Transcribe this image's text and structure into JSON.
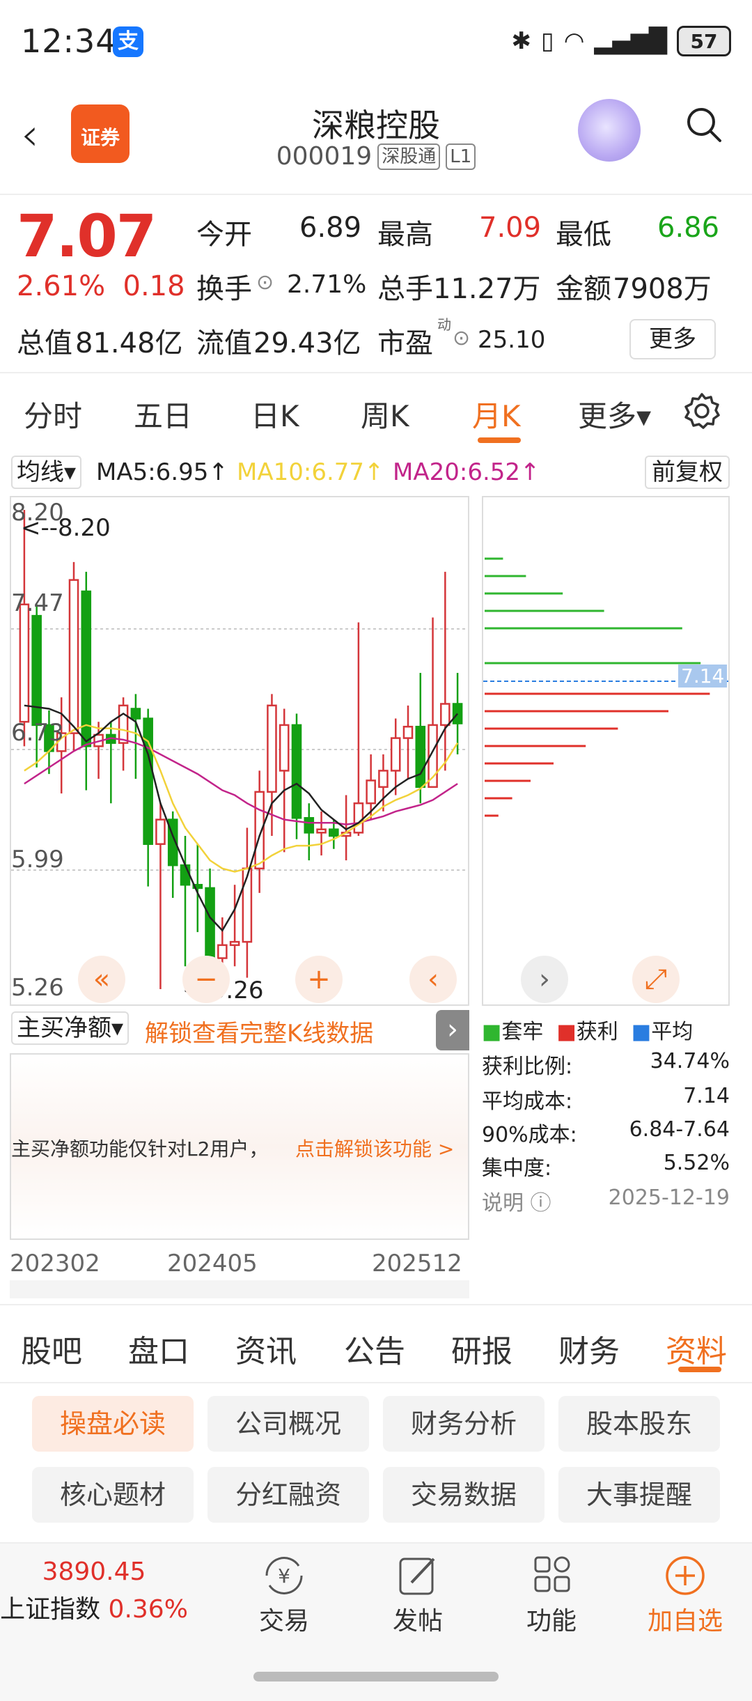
{
  "status_bar": {
    "time": "12:34",
    "alipay_badge": "支",
    "battery": "57"
  },
  "header": {
    "back_icon": "back-chevron-icon",
    "logo_text": "证券",
    "stock_name": "深粮控股",
    "stock_code": "000019",
    "tag_connect": "深股通",
    "tag_level": "L1"
  },
  "quote": {
    "price": "7.07",
    "change_pct": "2.61%",
    "change_amt": "0.18",
    "open_label": "今开",
    "open": "6.89",
    "high_label": "最高",
    "high": "7.09",
    "low_label": "最低",
    "low": "6.86",
    "turnover_label": "换手",
    "turnover": "2.71%",
    "volume_label": "总手",
    "volume": "11.27万",
    "amount_label": "金额",
    "amount": "7908万",
    "mktcap_label": "总值",
    "mktcap": "81.48亿",
    "float_label": "流值",
    "float": "29.43亿",
    "pe_label": "市盈",
    "pe_sup": "动",
    "pe": "25.10",
    "more_button": "更多"
  },
  "chart_tabs": [
    "分时",
    "五日",
    "日K",
    "周K",
    "月K",
    "更多▾"
  ],
  "active_chart_tab": "月K",
  "ma": {
    "selector": "均线▾",
    "ma5": "MA5:6.95↑",
    "ma10": "MA10:6.77↑",
    "ma20": "MA20:6.52↑",
    "adjust_button": "前复权",
    "ma5_color": "#222222",
    "ma10_color": "#f2d23a",
    "ma20_color": "#c2248a"
  },
  "kline": {
    "y_labels": [
      "8.20",
      "7.47",
      "6.73",
      "5.99",
      "5.26"
    ],
    "max_label": "<--8.20",
    "min_label": "<-5.26",
    "dates": [
      "202302",
      "202405",
      "202512"
    ],
    "up_color": "#d4363a",
    "down_color": "#13a013"
  },
  "chart_data": {
    "type": "candlestick",
    "ylim": [
      5.26,
      8.2
    ],
    "candles": [
      {
        "o": 6.9,
        "h": 8.2,
        "l": 6.75,
        "c": 7.62
      },
      {
        "o": 7.55,
        "h": 7.62,
        "l": 6.62,
        "c": 6.88
      },
      {
        "o": 6.88,
        "h": 6.97,
        "l": 6.58,
        "c": 6.72
      },
      {
        "o": 6.72,
        "h": 7.05,
        "l": 6.46,
        "c": 6.83
      },
      {
        "o": 6.83,
        "h": 7.88,
        "l": 6.72,
        "c": 7.77
      },
      {
        "o": 7.7,
        "h": 7.82,
        "l": 6.48,
        "c": 6.75
      },
      {
        "o": 6.75,
        "h": 6.9,
        "l": 6.55,
        "c": 6.82
      },
      {
        "o": 6.82,
        "h": 6.9,
        "l": 6.4,
        "c": 6.77
      },
      {
        "o": 6.77,
        "h": 7.05,
        "l": 6.6,
        "c": 7.0
      },
      {
        "o": 6.98,
        "h": 7.07,
        "l": 6.55,
        "c": 6.92
      },
      {
        "o": 6.92,
        "h": 6.98,
        "l": 5.89,
        "c": 6.15
      },
      {
        "o": 6.15,
        "h": 6.4,
        "l": 5.26,
        "c": 6.3
      },
      {
        "o": 6.3,
        "h": 6.35,
        "l": 5.82,
        "c": 6.02
      },
      {
        "o": 6.02,
        "h": 6.2,
        "l": 5.4,
        "c": 5.9
      },
      {
        "o": 5.9,
        "h": 6.15,
        "l": 5.61,
        "c": 5.88
      },
      {
        "o": 5.88,
        "h": 6.0,
        "l": 5.4,
        "c": 5.45
      },
      {
        "o": 5.45,
        "h": 5.7,
        "l": 5.33,
        "c": 5.53
      },
      {
        "o": 5.53,
        "h": 5.9,
        "l": 5.4,
        "c": 5.55
      },
      {
        "o": 5.55,
        "h": 6.25,
        "l": 5.33,
        "c": 6.0
      },
      {
        "o": 6.0,
        "h": 6.6,
        "l": 5.85,
        "c": 6.47
      },
      {
        "o": 6.47,
        "h": 7.07,
        "l": 6.2,
        "c": 7.0
      },
      {
        "o": 6.6,
        "h": 6.98,
        "l": 6.1,
        "c": 6.88
      },
      {
        "o": 6.88,
        "h": 6.95,
        "l": 6.18,
        "c": 6.31
      },
      {
        "o": 6.31,
        "h": 6.4,
        "l": 6.05,
        "c": 6.22
      },
      {
        "o": 6.22,
        "h": 6.35,
        "l": 6.08,
        "c": 6.24
      },
      {
        "o": 6.24,
        "h": 6.3,
        "l": 6.12,
        "c": 6.2
      },
      {
        "o": 6.2,
        "h": 6.45,
        "l": 6.05,
        "c": 6.22
      },
      {
        "o": 6.22,
        "h": 7.51,
        "l": 6.2,
        "c": 6.4
      },
      {
        "o": 6.4,
        "h": 6.7,
        "l": 6.3,
        "c": 6.54
      },
      {
        "o": 6.5,
        "h": 6.7,
        "l": 6.35,
        "c": 6.6
      },
      {
        "o": 6.6,
        "h": 6.92,
        "l": 6.45,
        "c": 6.8
      },
      {
        "o": 6.8,
        "h": 7.0,
        "l": 6.55,
        "c": 6.87
      },
      {
        "o": 6.87,
        "h": 7.2,
        "l": 6.4,
        "c": 6.5
      },
      {
        "o": 6.5,
        "h": 7.54,
        "l": 6.5,
        "c": 6.88
      },
      {
        "o": 6.88,
        "h": 7.82,
        "l": 6.6,
        "c": 7.01
      },
      {
        "o": 7.01,
        "h": 7.2,
        "l": 6.7,
        "c": 6.89
      }
    ],
    "ma5": [
      7.0,
      6.99,
      6.98,
      6.95,
      6.87,
      6.78,
      6.83,
      6.9,
      6.95,
      6.9,
      6.7,
      6.4,
      6.2,
      6.02,
      5.85,
      5.7,
      5.62,
      5.75,
      5.95,
      6.2,
      6.4,
      6.48,
      6.52,
      6.46,
      6.36,
      6.3,
      6.24,
      6.28,
      6.35,
      6.43,
      6.5,
      6.55,
      6.58,
      6.72,
      6.86,
      6.95
    ],
    "ma10": [
      6.6,
      6.65,
      6.72,
      6.8,
      6.85,
      6.88,
      6.86,
      6.86,
      6.85,
      6.83,
      6.78,
      6.6,
      6.4,
      6.25,
      6.15,
      6.05,
      6.0,
      5.98,
      6.0,
      6.03,
      6.08,
      6.12,
      6.14,
      6.14,
      6.15,
      6.18,
      6.22,
      6.27,
      6.32,
      6.38,
      6.42,
      6.45,
      6.49,
      6.56,
      6.65,
      6.77
    ],
    "ma20": [
      6.52,
      6.57,
      6.62,
      6.67,
      6.72,
      6.76,
      6.78,
      6.8,
      6.79,
      6.77,
      6.74,
      6.7,
      6.66,
      6.62,
      6.58,
      6.53,
      6.48,
      6.45,
      6.4,
      6.36,
      6.33,
      6.3,
      6.29,
      6.28,
      6.28,
      6.28,
      6.27,
      6.28,
      6.3,
      6.32,
      6.35,
      6.37,
      6.39,
      6.42,
      6.47,
      6.52
    ]
  },
  "chip_distribution": {
    "avg_label": "7.14",
    "bars_profit": [
      0.08,
      0.18,
      0.34,
      0.52,
      0.86
    ],
    "bars_trapped": [
      0.98,
      0.8,
      0.58,
      0.44,
      0.3,
      0.2,
      0.12,
      0.06
    ],
    "legend": [
      "套牢",
      "获利",
      "平均"
    ],
    "legend_colors": [
      "#2fb62f",
      "#e0302a",
      "#2a7de0"
    ]
  },
  "indicator": {
    "selector": "主买净额▾",
    "unlock_link": "解锁查看完整K线数据",
    "notice": "主买净额功能仅针对L2用户，",
    "notice_link": "点击解锁该功能 >"
  },
  "chip_stats": [
    {
      "label": "获利比例:",
      "value": "34.74%"
    },
    {
      "label": "平均成本:",
      "value": "7.14"
    },
    {
      "label": "90%成本:",
      "value": "6.84-7.64"
    },
    {
      "label": "集中度:",
      "value": "5.52%"
    },
    {
      "label": "说明",
      "value": "2025-12-19"
    }
  ],
  "section_tabs": [
    "股吧",
    "盘口",
    "资讯",
    "公告",
    "研报",
    "财务",
    "资料"
  ],
  "active_section_tab": "资料",
  "info_buttons": [
    "操盘必读",
    "公司概况",
    "财务分析",
    "股本股东",
    "核心题材",
    "分红融资",
    "交易数据",
    "大事提醒"
  ],
  "bottom_bar": {
    "index_value": "3890.45",
    "index_name": "上证指数",
    "index_change": "0.36%",
    "items": [
      {
        "label": "交易",
        "icon": "yuan-cycle-icon"
      },
      {
        "label": "发帖",
        "icon": "edit-icon"
      },
      {
        "label": "功能",
        "icon": "grid-icon"
      },
      {
        "label": "加自选",
        "icon": "plus-circle-icon"
      }
    ]
  }
}
